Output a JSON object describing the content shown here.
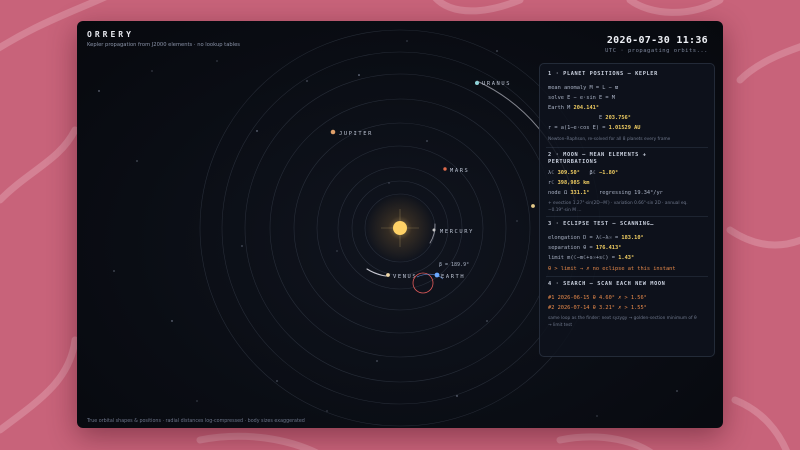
{
  "app": {
    "title": "ORRERY",
    "subtitle": "Kepler propagation from J2000 elements · no lookup tables",
    "clock": "2026-07-30 11:36",
    "clock_sub": "UTC · propagating orbits...",
    "footer": "True orbital shapes & positions · radial distances log-compressed · body sizes exaggerated"
  },
  "planets": {
    "uranus": "URANUS",
    "jupiter": "JUPITER",
    "mars": "MARS",
    "mercury": "MERCURY",
    "venus": "VENUS",
    "earth": "EARTH"
  },
  "moon_readout": "β = 189.9°",
  "panel": {
    "s1": {
      "title": "1 · PLANET POSITIONS — KEPLER",
      "l1": "mean anomaly  M = L − ϖ",
      "l2": "solve  E − e·sin E = M",
      "earth_label": "Earth  M",
      "earth_m": "204.141°",
      "e_label": "E",
      "earth_e": "203.756°",
      "r_label": "r = a(1−e·cos E) =",
      "r_val": "1.01529 AU",
      "note": "Newton–Raphson, re-solved for all 8 planets every frame"
    },
    "s2": {
      "title_a": "2 · MOON — MEAN ELEMENTS +",
      "title_b": "PERTURBATIONS",
      "lam_label": "λ☾",
      "lam_val": "309.50°",
      "beta_label": "β☾",
      "beta_val": "−1.80°",
      "r_label": "r☾",
      "r_val": "398,985 km",
      "node_label": "node Ω",
      "node_val": "331.1°",
      "node_note": "regressing 19.34°/yr",
      "note_a": "+ evection 1.27°·sin(2D−M′) · variation 0.66°·sin 2D · annual eq.",
      "note_b": "−0.19°·sin M …"
    },
    "s3": {
      "title": "3 · ECLIPSE TEST — SCANNING…",
      "elong_label": "elongation  D = λ☾−λ☉ =",
      "elong_val": "183.10°",
      "sep_label": "separation  θ =",
      "sep_val": "176.413°",
      "limit_label": "limit  m(☾−m☾+s☉+s☾) =",
      "limit_val": "1.43°",
      "verdict": "θ > limit  →  ✗ no eclipse at this instant"
    },
    "s4": {
      "title": "4 · SEARCH — SCAN EACH NEW MOON",
      "row1": "#1  2026-06-15  θ 4.60°  ✗ > 1.56°",
      "row2": "#2  2026-07-14  θ 3.21°  ✗ > 1.55°",
      "note_a": "same loop as the finder: next syzygy → golden-section minimum of θ",
      "note_b": "→ limit test"
    }
  },
  "colors": {
    "background": "#c8637a",
    "window": "#0a0d14",
    "accent_value": "#f2cf63",
    "warn": "#e06a5a",
    "sun": "#ffd266",
    "earth": "#6aa8ff"
  }
}
